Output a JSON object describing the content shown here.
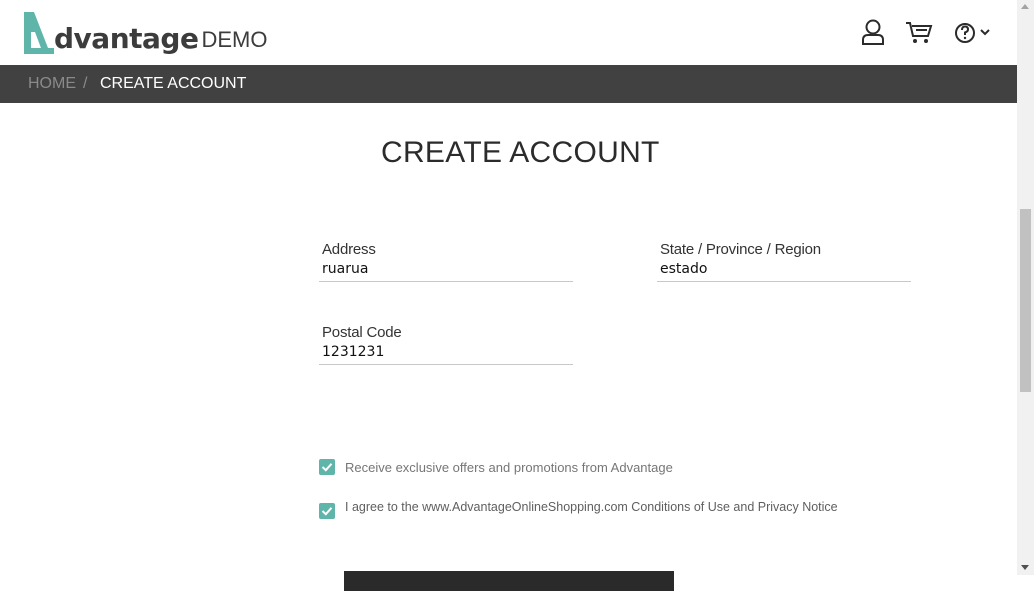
{
  "header": {
    "logo_main": "dvantage",
    "logo_suffix": "DEMO",
    "icons": [
      "user-icon",
      "cart-icon",
      "help-icon",
      "chevron-down-icon"
    ]
  },
  "breadcrumb": {
    "home": "HOME",
    "separator": "/",
    "current": "CREATE ACCOUNT"
  },
  "page": {
    "title": "CREATE ACCOUNT"
  },
  "form": {
    "address": {
      "label": "Address",
      "value": "ruarua"
    },
    "state": {
      "label": "State / Province / Region",
      "value": "estado"
    },
    "postal": {
      "label": "Postal Code",
      "value": "1231231"
    }
  },
  "checkboxes": {
    "offers": {
      "label": "Receive exclusive offers and promotions from Advantage",
      "checked": true
    },
    "agree": {
      "label": "I agree to the www.AdvantageOnlineShopping.com Conditions of Use and Privacy Notice",
      "checked": true
    }
  },
  "colors": {
    "accent": "#5fb5a9",
    "breadcrumb_bg": "#414141",
    "logo_mark": "#5fb5a9"
  }
}
